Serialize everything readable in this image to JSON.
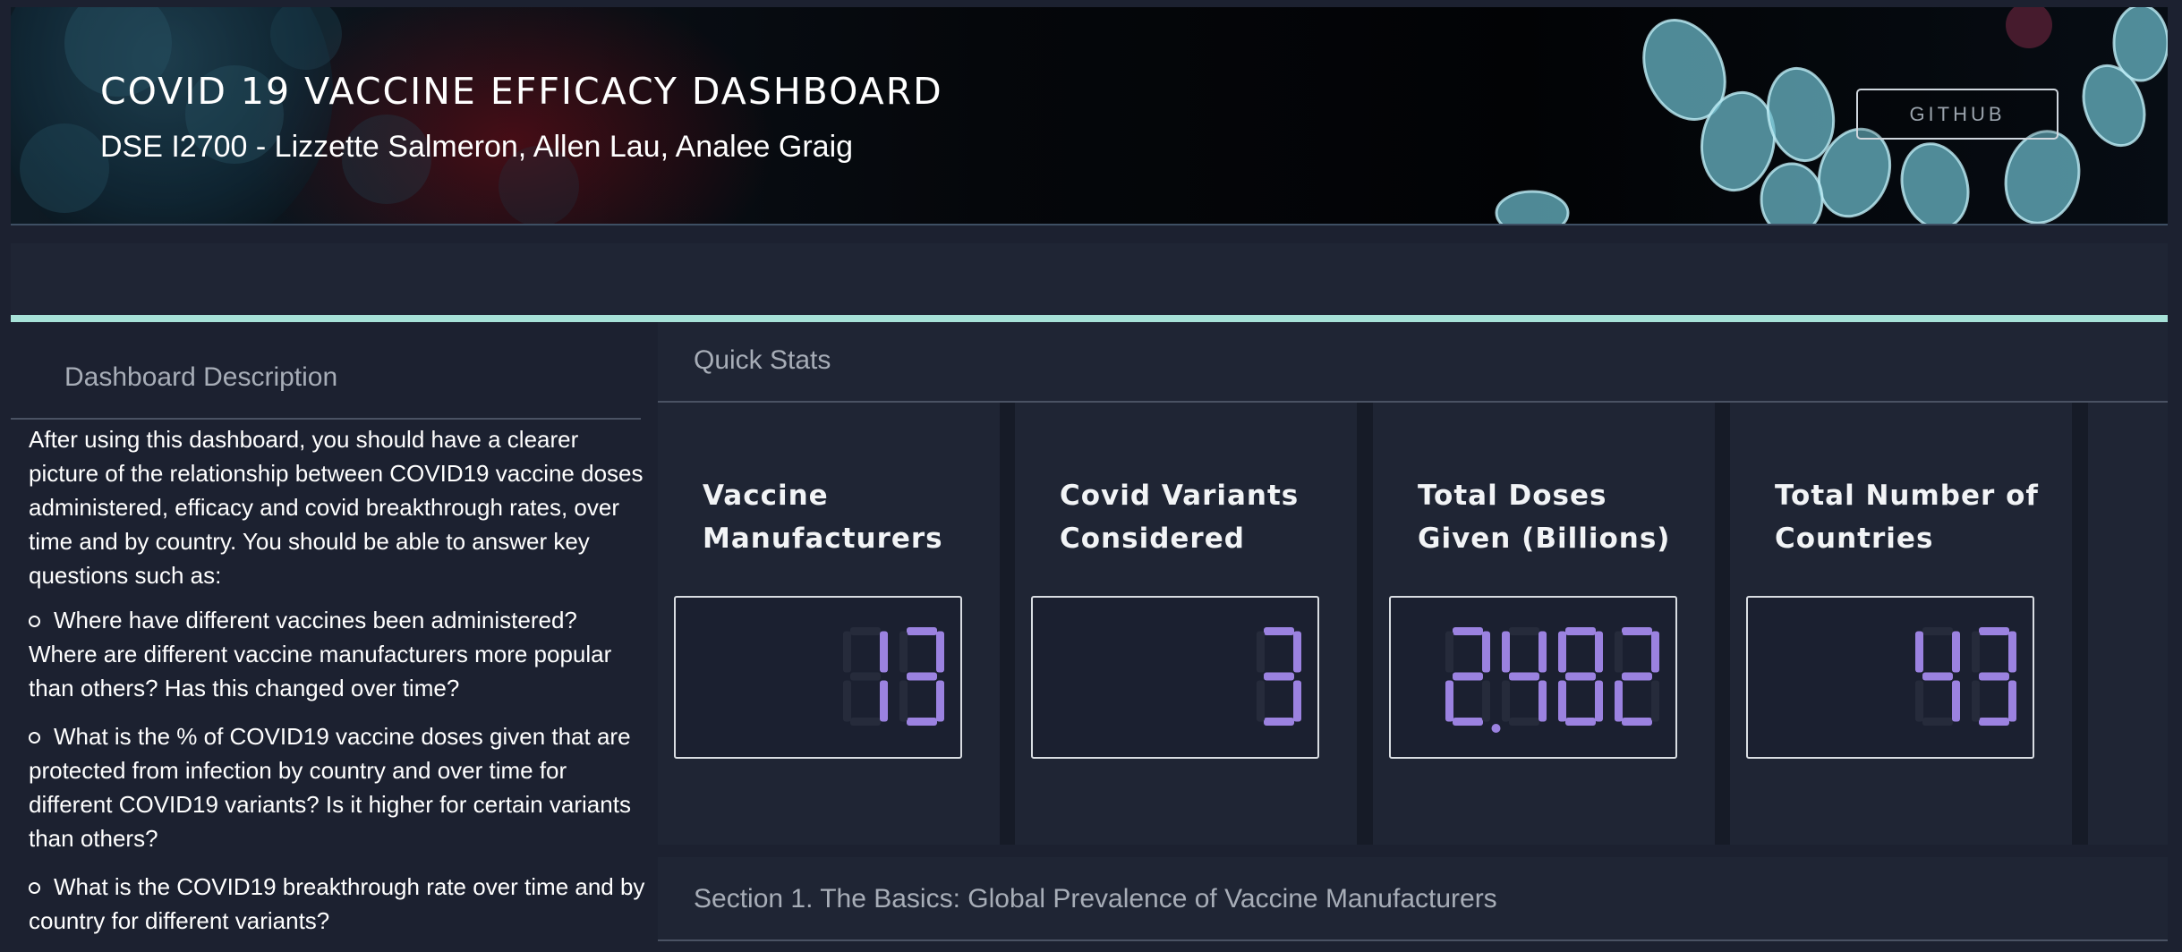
{
  "header": {
    "title": "COVID 19 VACCINE EFFICACY DASHBOARD",
    "subtitle": "DSE I2700 - Lizzette Salmeron, Allen Lau, Analee Graig",
    "github_label": "GITHUB"
  },
  "sidebar": {
    "heading": "Dashboard Description",
    "intro": "After using this dashboard, you should have a clearer picture of the relationship between COVID19 vaccine doses administered, efficacy and covid breakthrough rates, over time and by country. You should   be able to answer key questions such as:",
    "bullets": [
      "Where have different vaccines been administered? Where are different vaccine manufacturers more popular than others? Has this changed over time?",
      "What is the % of COVID19 vaccine doses given that are protected from infection by country and over time for different COVID19 variants? Is it higher for certain variants than others?",
      "What is the COVID19 breakthrough rate over time and by country for different variants?"
    ]
  },
  "quick_stats": {
    "heading": "Quick Stats",
    "cards": [
      {
        "label": "Vaccine Manufacturers",
        "value": "13"
      },
      {
        "label": "Covid Variants Considered",
        "value": "3"
      },
      {
        "label": "Total Doses Given (Billions)",
        "value": "2.482"
      },
      {
        "label": "Total Number of Countries",
        "value": "43"
      }
    ]
  },
  "section1": {
    "heading": "Section 1. The Basics: Global Prevalence of Vaccine Manufacturers"
  },
  "colors": {
    "background": "#1c2130",
    "panel": "#1f2534",
    "accent_bar": "#a7e2d8",
    "lcd_digit": "#9b82e0",
    "lcd_ghost": "#262b3b"
  },
  "icons": [
    "coronavirus-illustration"
  ]
}
